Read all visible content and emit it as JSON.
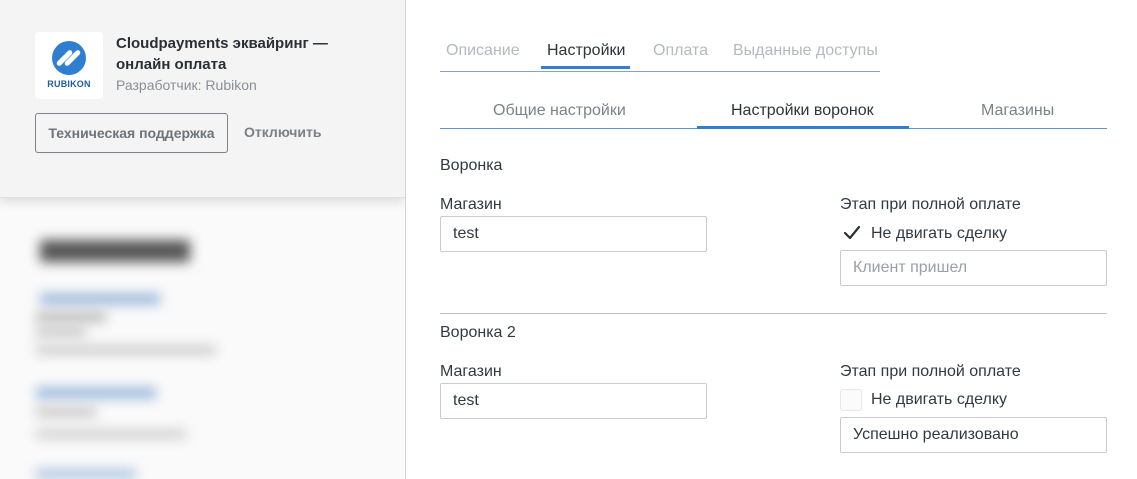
{
  "app": {
    "title": "Cloudpayments эквайринг — онлайн оплата",
    "developer": "Разработчик: Rubikon",
    "logo_text": "RUBIKON",
    "support_button": "Техническая поддержка",
    "disable_button": "Отключить"
  },
  "tabs": [
    {
      "label": "Описание",
      "active": false
    },
    {
      "label": "Настройки",
      "active": true
    },
    {
      "label": "Оплата",
      "active": false
    },
    {
      "label": "Выданные доступы",
      "active": false
    }
  ],
  "subtabs": [
    {
      "label": "Общие настройки",
      "active": false
    },
    {
      "label": "Настройки воронок",
      "active": true
    },
    {
      "label": "Магазины",
      "active": false
    }
  ],
  "funnels": [
    {
      "title": "Воронка",
      "shop_label": "Магазин",
      "shop_value": "test",
      "stage_label": "Этап при полной оплате",
      "checkbox_label": "Не двигать сделку",
      "checkbox_checked": true,
      "stage_value": "",
      "stage_placeholder": "Клиент пришел"
    },
    {
      "title": "Воронка 2",
      "shop_label": "Магазин",
      "shop_value": "test",
      "stage_label": "Этап при полной оплате",
      "checkbox_label": "Не двигать сделку",
      "checkbox_checked": false,
      "stage_value": "Успешно реализовано",
      "stage_placeholder": ""
    }
  ],
  "colors": {
    "accent": "#2f7fd1",
    "text": "#313942",
    "muted": "#b4b9bf"
  }
}
